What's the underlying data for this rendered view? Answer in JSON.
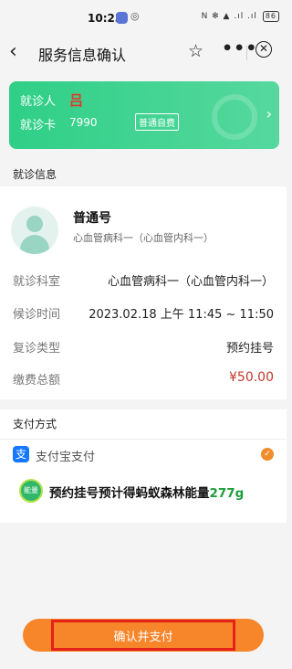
{
  "status_bar": {
    "time": "10:23",
    "right_icons": "N ✻ ▲ .ıl .ıl",
    "battery": "86"
  },
  "nav": {
    "title": "服务信息确认",
    "back_icon": "‹",
    "star_icon": "☆",
    "more_icon": "•••",
    "close_icon": "✕"
  },
  "patient_card": {
    "patient_label": "就诊人",
    "patient_name": "吕",
    "card_label": "就诊卡",
    "card_number": "7990",
    "card_type": "普通自费",
    "chevron": "›"
  },
  "visit_info": {
    "section_title": "就诊信息",
    "doctor_title": "普通号",
    "doctor_dept": "心血管病科一（心血管内科一）",
    "rows": [
      {
        "key": "就诊科室",
        "value": "心血管病科一（心血管内科一）"
      },
      {
        "key": "候诊时间",
        "value": "2023.02.18 上午 11:45 ~ 11:50"
      },
      {
        "key": "复诊类型",
        "value": "预约挂号"
      },
      {
        "key": "缴费总额",
        "value": "¥50.00"
      }
    ]
  },
  "payment": {
    "section_title": "支付方式",
    "method_icon": "支",
    "method_label": "支付宝支付",
    "check_icon": "✓",
    "energy_badge": "能量",
    "energy_text": "预约挂号预计得蚂蚁森林能量",
    "energy_amount": "277g"
  },
  "confirm_button": {
    "label": "确认并支付"
  }
}
